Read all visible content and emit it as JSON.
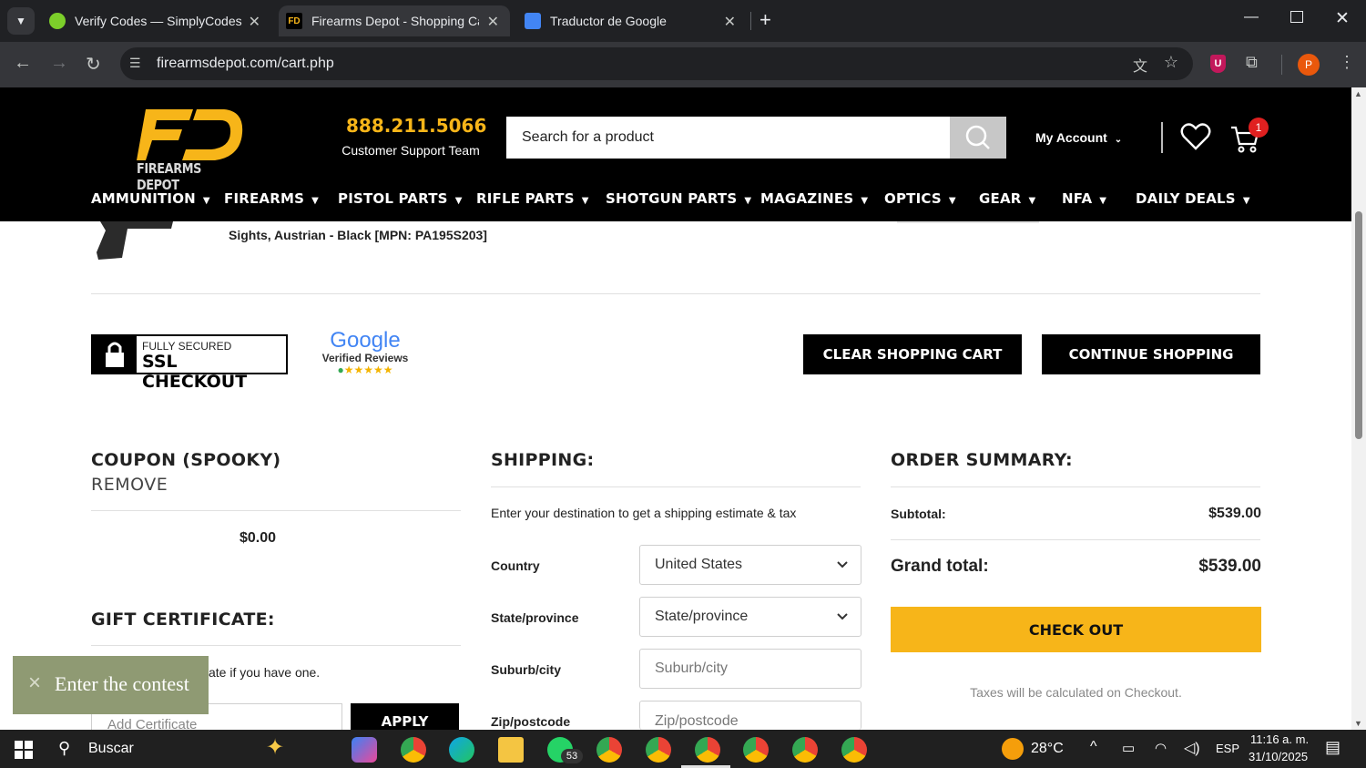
{
  "browser": {
    "tabs": [
      {
        "title": "Verify Codes — SimplyCodes",
        "active": false
      },
      {
        "title": "Firearms Depot - Shopping Cart",
        "active": true
      },
      {
        "title": "Traductor de Google",
        "active": false
      }
    ],
    "url": "firearmsdepot.com/cart.php",
    "profile_initial": "P"
  },
  "header": {
    "logo_text": "FIREARMS DEPOT",
    "phone": "888.211.5066",
    "support_label": "Customer Support Team",
    "search_placeholder": "Search for a product",
    "account_label": "My Account",
    "cart_count": "1"
  },
  "nav": [
    "AMMUNITION",
    "FIREARMS",
    "PISTOL PARTS",
    "RIFLE PARTS",
    "SHOTGUN PARTS",
    "MAGAZINES",
    "OPTICS",
    "GEAR",
    "NFA",
    "DAILY DEALS"
  ],
  "cart_item": {
    "name_fragment": "Sights, Austrian - Black [MPN: PA195S203]"
  },
  "badges": {
    "ssl_top": "FULLY SECURED",
    "ssl_bottom": "SSL CHECKOUT",
    "google_word": "Google",
    "google_sub": "Verified Reviews",
    "stars": "★★★★★"
  },
  "buttons": {
    "clear_cart": "CLEAR SHOPPING CART",
    "continue": "CONTINUE SHOPPING",
    "checkout": "CHECK OUT",
    "apply": "APPLY"
  },
  "coupon": {
    "title": "COUPON (SPOOKY)",
    "remove": "REMOVE",
    "amount": "$0.00"
  },
  "gift": {
    "title": "GIFT CERTIFICATE:",
    "hint_fragment": "ate if you have one.",
    "placeholder": "Add Certificate"
  },
  "shipping": {
    "title": "SHIPPING:",
    "intro": "Enter your destination to get a shipping estimate & tax",
    "fields": [
      {
        "label": "Country",
        "value": "United States",
        "select": true
      },
      {
        "label": "State/province",
        "value": "State/province",
        "select": true
      },
      {
        "label": "Suburb/city",
        "value": "Suburb/city",
        "select": false
      },
      {
        "label": "Zip/postcode",
        "value": "Zip/postcode",
        "select": false
      }
    ]
  },
  "summary": {
    "title": "ORDER SUMMARY:",
    "subtotal_label": "Subtotal:",
    "subtotal": "$539.00",
    "grand_label": "Grand total:",
    "grand": "$539.00",
    "tax_note": "Taxes will be calculated on Checkout."
  },
  "contest": {
    "label": "Enter the contest",
    "close": "×"
  },
  "taskbar": {
    "search": "Buscar",
    "badge_count": "53",
    "weather": "28°C",
    "lang": "ESP",
    "time": "11:16 a. m.",
    "date": "31/10/2025"
  },
  "colors": {
    "brand_yellow": "#f7b519",
    "black": "#000000",
    "contest_bg": "#8f9a73"
  }
}
